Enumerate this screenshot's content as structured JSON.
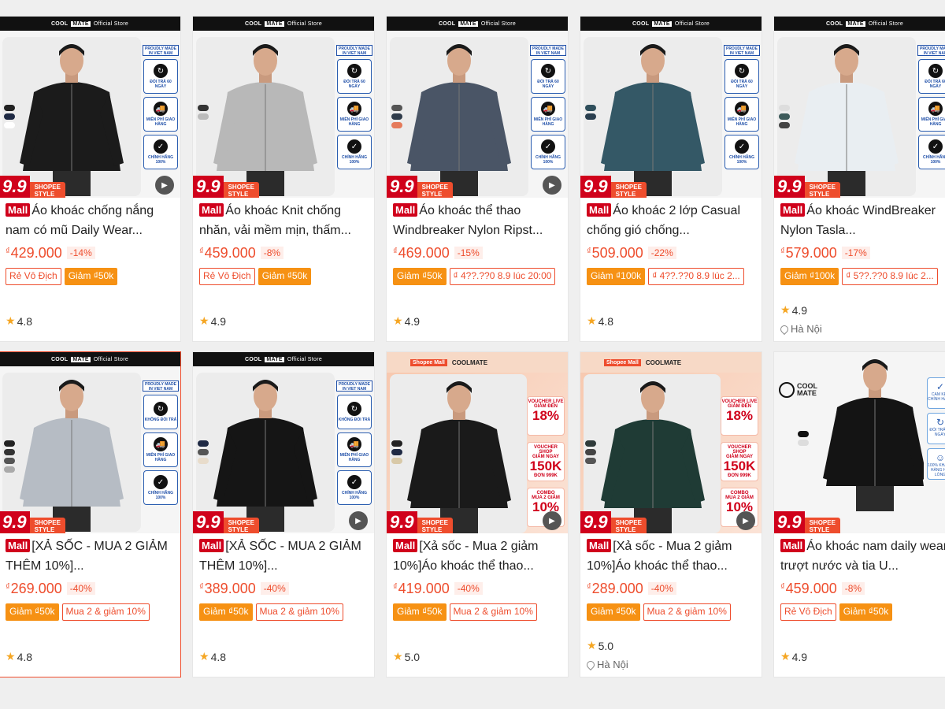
{
  "store_header": {
    "brand_a": "COOL",
    "brand_b": "MATE",
    "suffix": "Official Store"
  },
  "badges": {
    "made": "PROUDLY MADE IN VIET NAM",
    "return60": "ĐỔI TRẢ 60 NGÀY",
    "no_return": "KHÔNG ĐỔI TRẢ",
    "free_ship": "MIỄN PHÍ GIAO HÀNG",
    "genuine": "CHÍNH HÃNG 100%"
  },
  "promo": {
    "big": "9.9",
    "shopee": "SHOPEE",
    "style": "STYLE"
  },
  "mall_label": "Mall",
  "currency": "₫",
  "shopee_mall_bar": {
    "shopee_mall": "Shopee Mall",
    "brand": "COOLMATE"
  },
  "vouchers": [
    {
      "head": "VOUCHER LIVE",
      "sub": "GIẢM ĐẾN",
      "big": "18%"
    },
    {
      "head": "VOUCHER SHOP",
      "sub": "GIẢM NGAY",
      "big": "150K",
      "foot": "ĐƠN 999K"
    },
    {
      "head": "COMBO",
      "sub": "MUA 2 GIẢM",
      "big": "10%"
    }
  ],
  "card10_logo": {
    "a": "COOL",
    "b": "MATE"
  },
  "card10_badges": [
    "CAM KẾT CHÍNH HÃNG",
    "ĐỔI TRẢ 60 NGÀY",
    "100% KHÁCH HÀNG HÀI LÒNG"
  ],
  "products": [
    {
      "title": "Áo khoác chống nắng nam có mũ Daily Wear...",
      "price": "429.000",
      "discount": "-14%",
      "tags": [
        "Rẻ Vô Địch",
        "Giảm ₫50k"
      ],
      "rating": "4.8",
      "location": ""
    },
    {
      "title": "Áo khoác Knit chống nhăn, vải mềm mịn, thấm...",
      "price": "459.000",
      "discount": "-8%",
      "tags": [
        "Rẻ Vô Địch",
        "Giảm ₫50k"
      ],
      "rating": "4.9",
      "location": ""
    },
    {
      "title": "Áo khoác thể thao Windbreaker Nylon Ripst...",
      "price": "469.000",
      "discount": "-15%",
      "tags": [
        "Giảm ₫50k",
        "₫ 4??.??0 8.9 lúc 20:00"
      ],
      "rating": "4.9",
      "location": ""
    },
    {
      "title": "Áo khoác 2 lớp Casual chống gió chống...",
      "price": "509.000",
      "discount": "-22%",
      "tags": [
        "Giảm ₫100k",
        "₫ 4??.??0 8.9 lúc 2..."
      ],
      "rating": "4.8",
      "location": ""
    },
    {
      "title": "Áo khoác WindBreaker Nylon Tasla...",
      "price": "579.000",
      "discount": "-17%",
      "tags": [
        "Giảm ₫100k",
        "₫ 5??.??0 8.9 lúc 2..."
      ],
      "rating": "4.9",
      "location": "Hà Nội"
    },
    {
      "title": "[XẢ SỐC - MUA 2 GIẢM THÊM 10%]...",
      "price": "269.000",
      "discount": "-40%",
      "tags": [
        "Giảm ₫50k",
        "Mua 2 & giảm 10%"
      ],
      "rating": "4.8",
      "location": ""
    },
    {
      "title": "[XẢ SỐC - MUA 2 GIẢM THÊM 10%]...",
      "price": "389.000",
      "discount": "-40%",
      "tags": [
        "Giảm ₫50k",
        "Mua 2 & giảm 10%"
      ],
      "rating": "4.8",
      "location": ""
    },
    {
      "title": "[Xả sốc - Mua 2 giảm 10%]Áo khoác thể thao...",
      "price": "419.000",
      "discount": "-40%",
      "tags": [
        "Giảm ₫50k",
        "Mua 2 & giảm 10%"
      ],
      "rating": "5.0",
      "location": ""
    },
    {
      "title": "[Xả sốc - Mua 2 giảm 10%]Áo khoác thể thao...",
      "price": "289.000",
      "discount": "-40%",
      "tags": [
        "Giảm ₫50k",
        "Mua 2 & giảm 10%"
      ],
      "rating": "5.0",
      "location": "Hà Nội"
    },
    {
      "title": "Áo khoác nam daily wear trượt nước và tia U...",
      "price": "459.000",
      "discount": "-8%",
      "tags": [
        "Rẻ Vô Địch",
        "Giảm ₫50k"
      ],
      "rating": "4.9",
      "location": ""
    }
  ],
  "colors": {
    "accent": "#ee4d2d",
    "mall": "#d0011b",
    "voucher_fill": "#f69113",
    "star": "#f5a623"
  }
}
